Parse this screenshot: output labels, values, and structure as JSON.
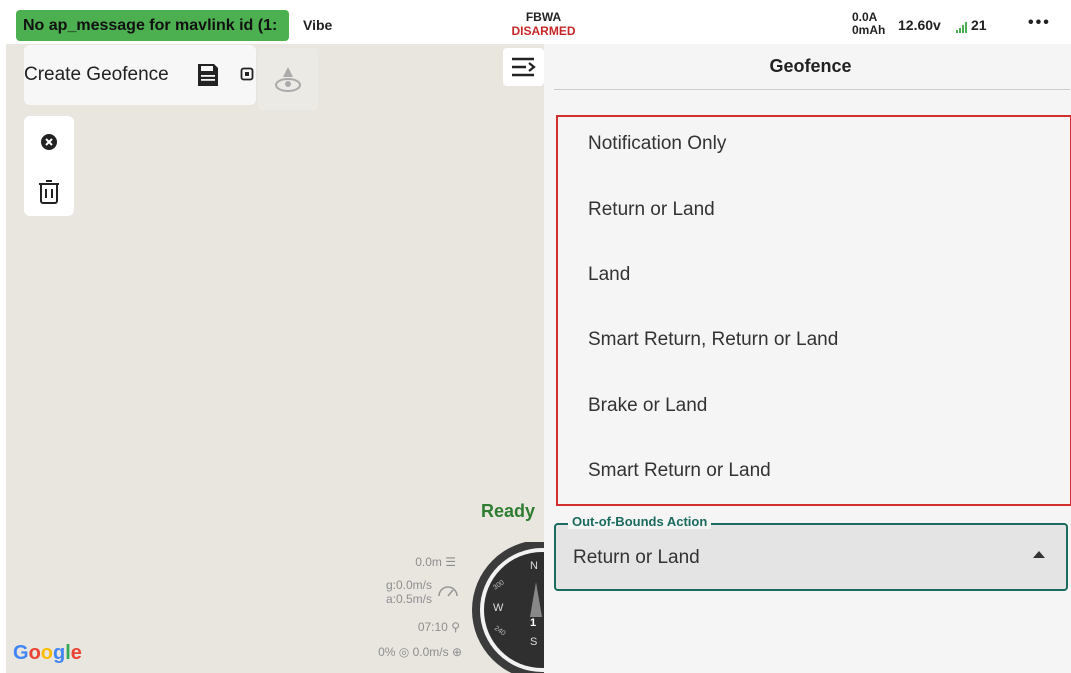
{
  "status_bar": {
    "message": "No ap_message for mavlink id (1:",
    "vehicle": "Vibe",
    "flight_mode": "FBWA",
    "arm_state": "DISARMED",
    "current": "0.0A",
    "capacity": "0mAh",
    "voltage": "12.60v",
    "satellites": "21",
    "more": "•••"
  },
  "toolbar": {
    "create_geofence": "Create Geofence"
  },
  "map": {
    "ready": "Ready",
    "altitude": "0.0m",
    "ground_speed": "g:0.0m/s",
    "air_speed": "a:0.5m/s",
    "flight_time": "07:10",
    "throttle": "0%",
    "climb_rate": "0.0m/s",
    "compass_n": "N",
    "compass_w": "W",
    "compass_s": "S",
    "compass_300": "300",
    "compass_240": "240",
    "compass_heading": "1",
    "google": {
      "g1": "G",
      "o1": "o",
      "o2": "o",
      "g2": "g",
      "l": "l",
      "e": "e"
    }
  },
  "panel": {
    "title": "Geofence",
    "dropdown_options": [
      "Notification Only",
      "Return or Land",
      "Land",
      "Smart Return, Return or Land",
      "Brake or Land",
      "Smart Return or Land"
    ],
    "field": {
      "label": "Out-of-Bounds Action",
      "value": "Return or Land"
    }
  },
  "colors": {
    "status_green": "#4caf50",
    "disarmed_red": "#c62828",
    "accent_teal": "#1b6b5e",
    "highlight_red": "#d32f2f"
  },
  "icons": [
    "save-icon",
    "small-square-icon",
    "vehicle-location-icon",
    "close-circle-icon",
    "trash-icon",
    "menu-collapse-icon",
    "signal-icon",
    "dropdown-caret-icon"
  ]
}
